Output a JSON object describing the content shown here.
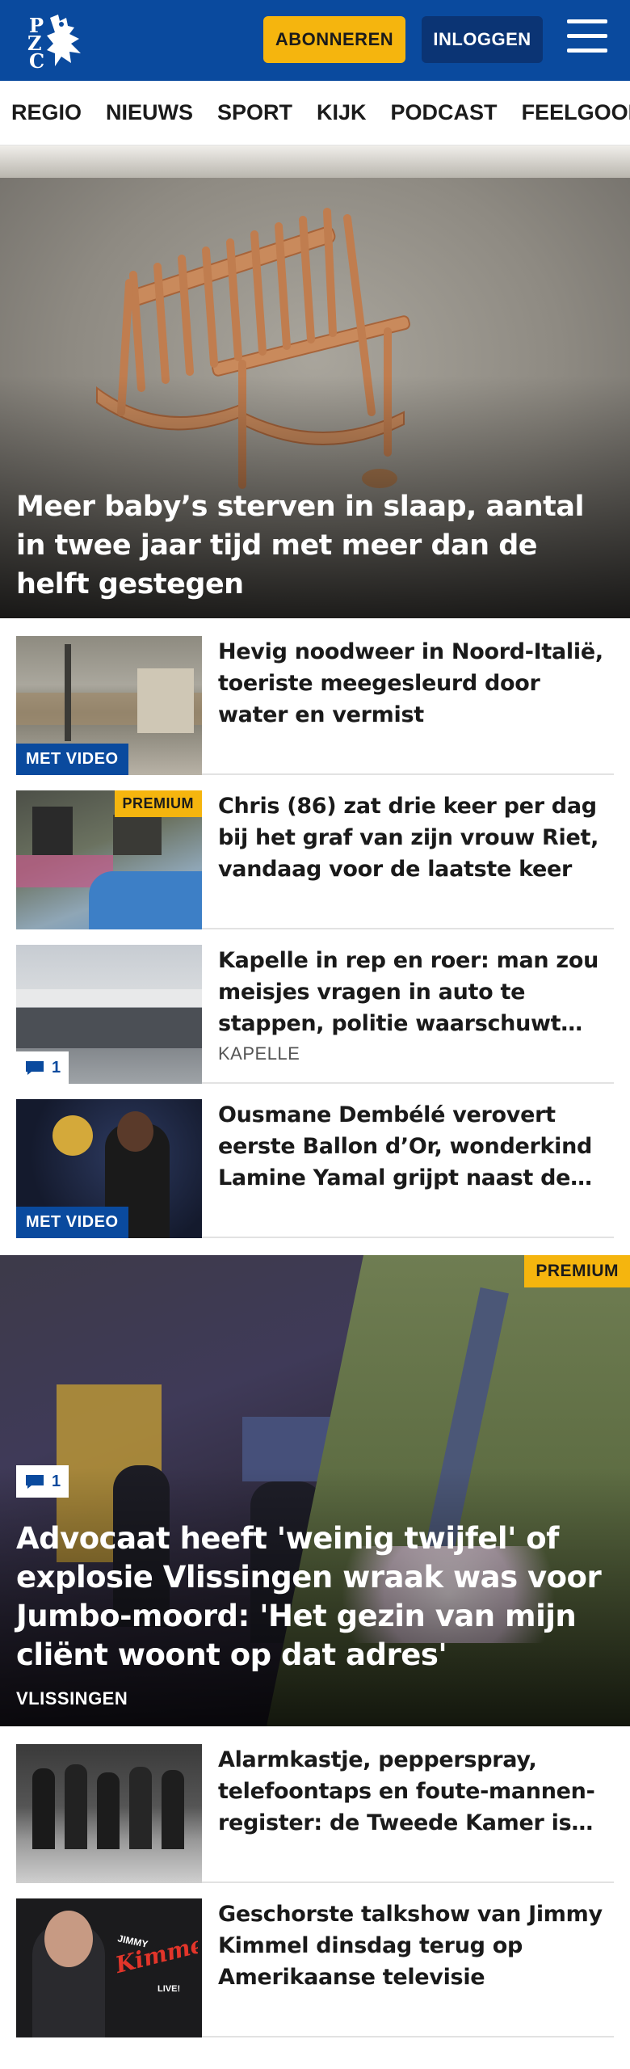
{
  "header": {
    "logo_text": "PZC",
    "subscribe_label": "ABONNEREN",
    "login_label": "INLOGGEN",
    "colors": {
      "brand_blue": "#0a4a9e",
      "accent_yellow": "#f5b50e",
      "login_blue": "#0b3474"
    }
  },
  "nav": {
    "items": [
      "REGIO",
      "NIEUWS",
      "SPORT",
      "KIJK",
      "PODCAST",
      "FEELGOOD"
    ]
  },
  "hero": {
    "title": "Meer baby’s sterven in slaap, aantal in twee jaar tijd met meer dan de helft gestegen"
  },
  "articles": [
    {
      "title": "Hevig noodweer in Noord-Italië, toeriste meegesleurd door water en vermist",
      "badge": "MET VIDEO"
    },
    {
      "title": "Chris (86) zat drie keer per dag bij het graf van zijn vrouw Riet, vandaag voor de laatste keer",
      "badge": "PREMIUM"
    },
    {
      "title": "Kapelle in rep en roer: man zou meisjes vragen in auto te stappen, politie waarschuwt voor onbekende man",
      "region": "KAPELLE",
      "comments": "1"
    },
    {
      "title": "Ousmane Dembélé verovert eerste Ballon d’Or, wonderkind Lamine Yamal grijpt naast de prijs",
      "badge": "MET VIDEO"
    }
  ],
  "feature": {
    "title": "Advocaat heeft 'weinig twijfel' of explosie Vlissingen wraak was voor Jumbo-moord: 'Het gezin van mijn cliënt woont op dat adres'",
    "region": "VLISSINGEN",
    "badge": "PREMIUM",
    "comments": "1"
  },
  "articles2": [
    {
      "title": "Alarmkastje, pepperspray, telefoontaps en foute-mannen-register: de Tweede Kamer is het erover eens"
    },
    {
      "title": "Geschorste talkshow van Jimmy Kimmel dinsdag terug op Amerikaanse televisie"
    }
  ],
  "thumb_texts": {
    "kimmel_sign": "JIMMY Kimmel LIVE!"
  }
}
